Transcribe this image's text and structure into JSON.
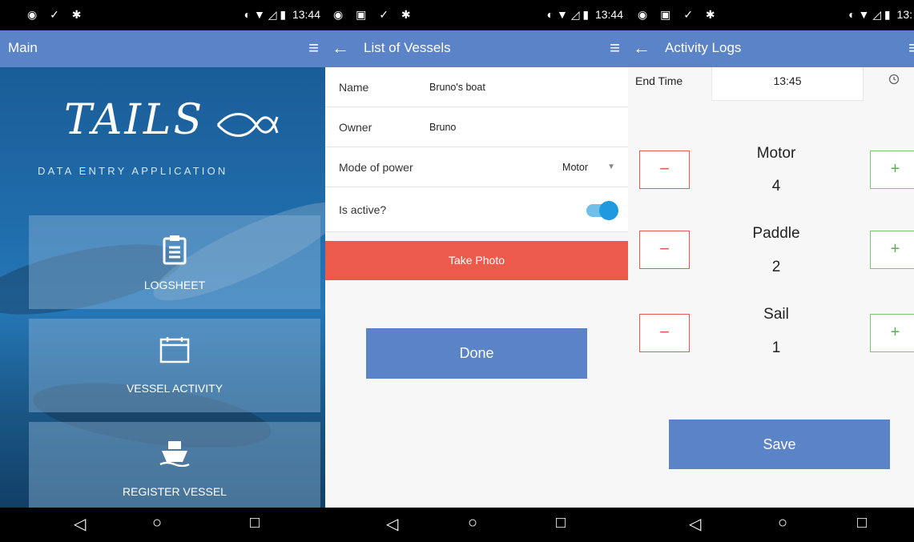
{
  "status_bar": {
    "time": "13:44",
    "time_partial": "13:"
  },
  "main": {
    "title": "Main",
    "logo_text": "TAILS",
    "subtitle": "DATA ENTRY APPLICATION",
    "tiles": [
      {
        "label": "LOGSHEET",
        "icon": "clipboard-icon"
      },
      {
        "label": "VESSEL ACTIVITY",
        "icon": "calendar-icon"
      },
      {
        "label": "REGISTER VESSEL",
        "icon": "boat-icon"
      }
    ]
  },
  "vessels": {
    "title": "List of Vessels",
    "name_label": "Name",
    "name_value": "Bruno's boat",
    "owner_label": "Owner",
    "owner_value": "Bruno",
    "power_label": "Mode of power",
    "power_value": "Motor",
    "active_label": "Is active?",
    "active_state": true,
    "photo_button": "Take Photo",
    "done_button": "Done"
  },
  "activity": {
    "title": "Activity Logs",
    "end_time_label": "End Time",
    "end_time_value": "13:45",
    "counters": [
      {
        "name": "Motor",
        "value": "4"
      },
      {
        "name": "Paddle",
        "value": "2"
      },
      {
        "name": "Sail",
        "value": "1"
      }
    ],
    "minus_symbol": "−",
    "plus_symbol": "+",
    "save_button": "Save"
  },
  "colors": {
    "app_bar": "#5b83c8",
    "photo_button": "#ec5a4c",
    "minus": "#e65b4f",
    "plus": "#5aae5a",
    "toggle": "#1e9be0"
  }
}
